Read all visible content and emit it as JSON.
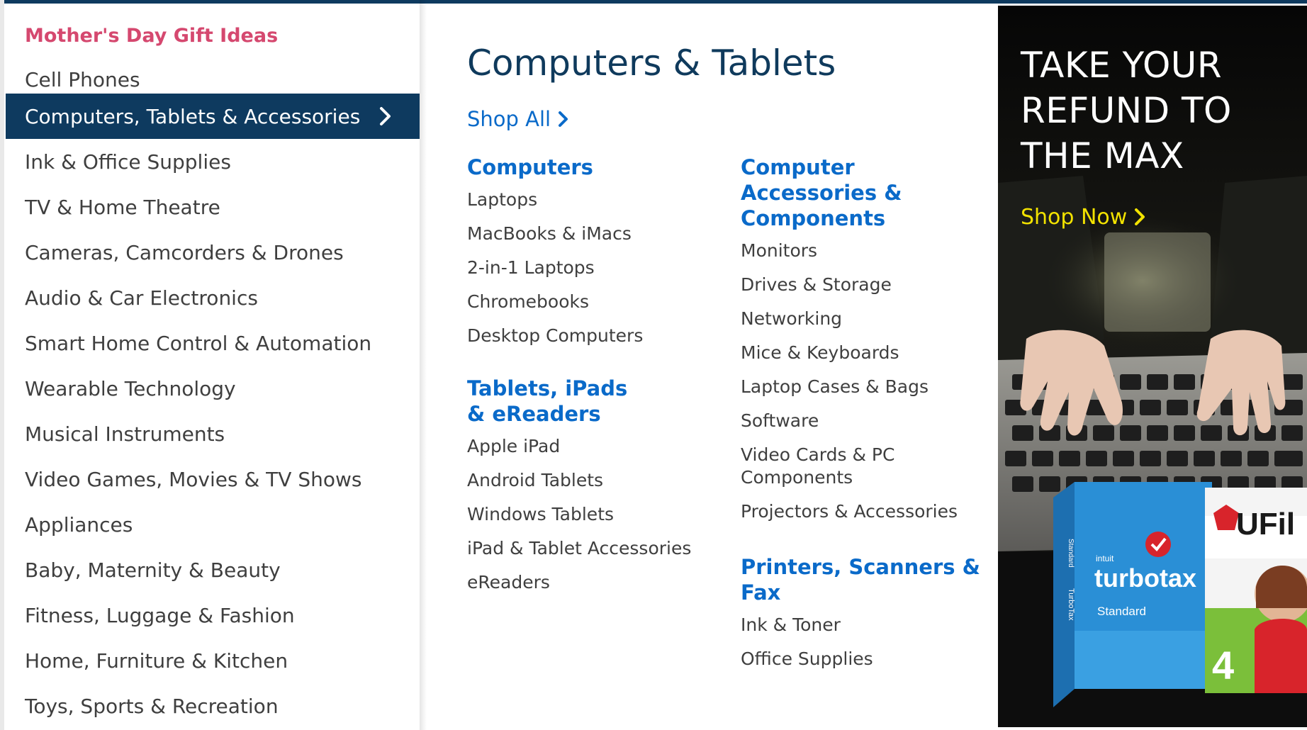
{
  "sidebar": {
    "promo_label": "Mother's Day Gift Ideas",
    "items": [
      {
        "label": "Cell Phones"
      },
      {
        "label": "Computers, Tablets & Accessories",
        "active": true
      },
      {
        "label": "Ink & Office Supplies"
      },
      {
        "label": "TV & Home Theatre"
      },
      {
        "label": "Cameras, Camcorders & Drones"
      },
      {
        "label": "Audio & Car Electronics"
      },
      {
        "label": "Smart Home Control & Automation"
      },
      {
        "label": "Wearable Technology"
      },
      {
        "label": "Musical Instruments"
      },
      {
        "label": "Video Games, Movies & TV Shows"
      },
      {
        "label": "Appliances"
      },
      {
        "label": "Baby, Maternity & Beauty"
      },
      {
        "label": "Fitness, Luggage & Fashion"
      },
      {
        "label": "Home, Furniture & Kitchen"
      },
      {
        "label": "Toys, Sports & Recreation"
      }
    ],
    "active_chevron_icon": "chevron-right-icon"
  },
  "main": {
    "title": "Computers & Tablets",
    "shop_all_label": "Shop All",
    "shop_all_icon": "chevron-right-icon",
    "columns": [
      {
        "sections": [
          {
            "heading": "Computers",
            "links": [
              "Laptops",
              "MacBooks & iMacs",
              "2-in-1 Laptops",
              "Chromebooks",
              "Desktop Computers"
            ]
          },
          {
            "heading": "Tablets, iPads & eReaders",
            "links": [
              "Apple iPad",
              "Android Tablets",
              "Windows Tablets",
              "iPad & Tablet Accessories",
              "eReaders"
            ]
          }
        ]
      },
      {
        "sections": [
          {
            "heading": "Computer Accessories & Components",
            "links": [
              "Monitors",
              "Drives & Storage",
              "Networking",
              "Mice & Keyboards",
              "Laptop Cases & Bags",
              "Software",
              "Video Cards & PC Components",
              "Projectors & Accessories"
            ]
          },
          {
            "heading": "Printers, Scanners & Fax",
            "links": [
              "Ink & Toner",
              "Office Supplies"
            ]
          }
        ]
      }
    ]
  },
  "ad": {
    "headline": "TAKE YOUR REFUND TO THE MAX",
    "cta_label": "Shop Now",
    "cta_icon": "chevron-right-icon",
    "product_1": {
      "brand_small": "intuit",
      "brand": "turbotax",
      "edition": "Standard",
      "spine": "TurboTax",
      "spine_edition": "Standard"
    },
    "product_2": {
      "brand": "UFil",
      "number": "4"
    },
    "colors": {
      "cta": "#f2e200",
      "turbotax_box": "#2a8fd6",
      "ufile_red": "#d8242b",
      "ufile_green": "#7bbf3a"
    }
  },
  "colors": {
    "nav_active": "#0e3a5f",
    "promo_pink": "#d5486f",
    "link_blue": "#0a6ac9",
    "title_navy": "#0f3a5c",
    "text_gray": "#3f3f3f"
  }
}
